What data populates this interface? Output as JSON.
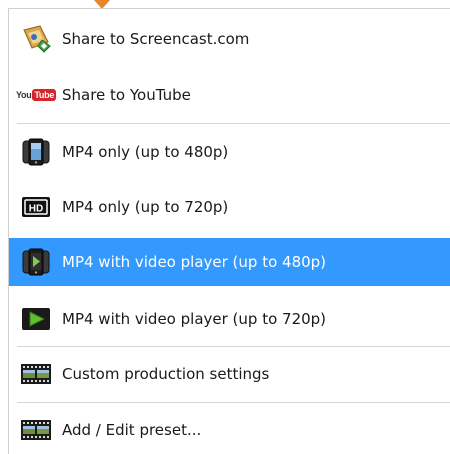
{
  "menu": {
    "items": [
      {
        "label": "Share to Screencast.com",
        "icon": "screencast-icon"
      },
      {
        "label": "Share to YouTube",
        "icon": "youtube-icon",
        "icon_text_you": "You",
        "icon_text_tube": "Tube"
      },
      {
        "label": "MP4 only (up to 480p)",
        "icon": "mobile-device-icon"
      },
      {
        "label": "MP4 only (up to 720p)",
        "icon": "hd-icon",
        "icon_text": "HD"
      },
      {
        "label": "MP4 with video player (up to 480p)",
        "icon": "mobile-play-icon",
        "highlighted": true
      },
      {
        "label": "MP4 with video player (up to 720p)",
        "icon": "play-icon"
      },
      {
        "label": "Custom production settings",
        "icon": "film-strip-icon"
      },
      {
        "label": "Add / Edit preset...",
        "icon": "film-strip-icon"
      }
    ]
  },
  "colors": {
    "highlight": "#3399ff",
    "pointer": "#e8862b",
    "youtube_red": "#d8232a"
  }
}
